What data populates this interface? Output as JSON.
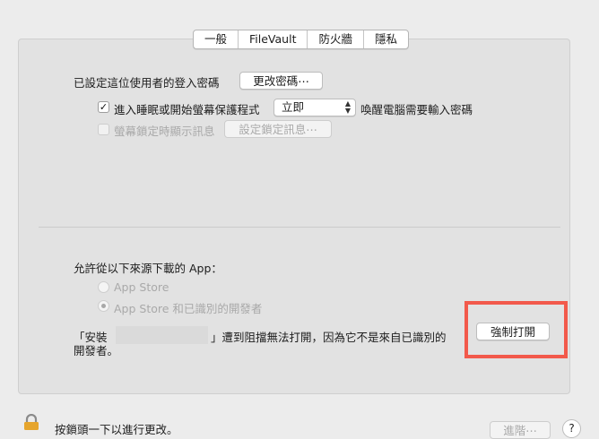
{
  "tabs": [
    "一般",
    "FileVault",
    "防火牆",
    "隱私"
  ],
  "password": {
    "label": "已設定這位使用者的登入密碼",
    "change_button": "更改密碼⋯"
  },
  "sleep": {
    "checked": true,
    "checkmark": "✓",
    "label": "進入睡眠或開始螢幕保護程式",
    "select_value": "立即",
    "select_arrows": "⌃⌄",
    "suffix": "喚醒電腦需要輸入密碼"
  },
  "lock_message": {
    "checked": false,
    "label": "螢幕鎖定時顯示訊息",
    "button": "設定鎖定訊息⋯"
  },
  "downloads": {
    "title": "允許從以下來源下載的 App：",
    "options": [
      "App Store",
      "App Store 和已識別的開發者"
    ],
    "selected_index": 1
  },
  "blocked": {
    "prefix": "「安裝",
    "suffix": "」遭到阻擋無法打開，因為它不是來自已識別的",
    "line2": "開發者。",
    "open_button": "強制打開"
  },
  "footer": {
    "lock_text": "按鎖頭一下以進行更改。",
    "advanced_button": "進階⋯",
    "help": "?"
  },
  "colors": {
    "highlight": "#f2594b"
  }
}
